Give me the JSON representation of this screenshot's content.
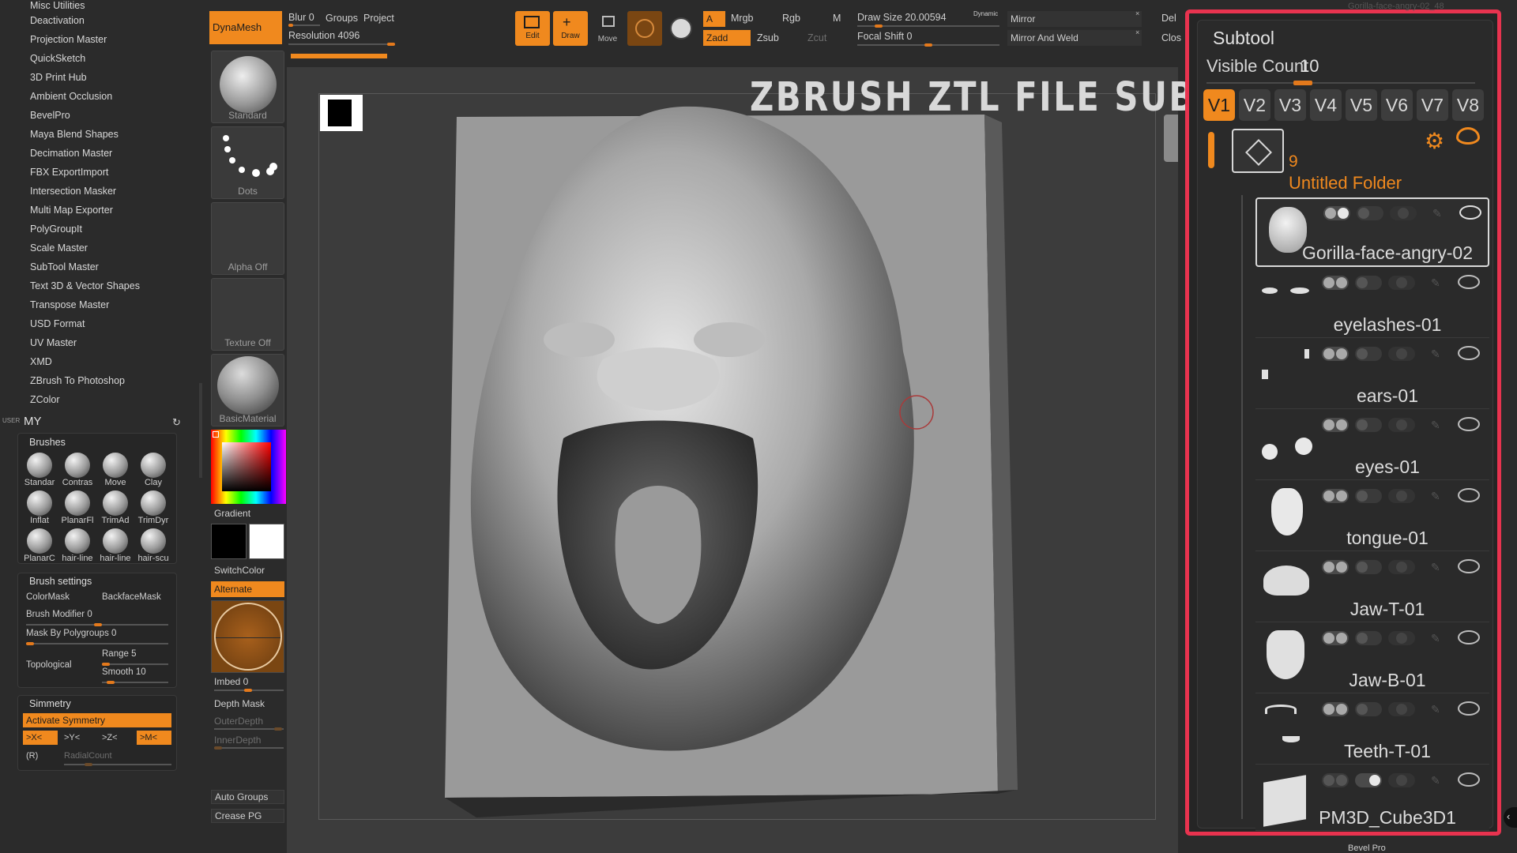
{
  "plugins": [
    "Misc Utilities",
    "Deactivation",
    "Projection Master",
    "QuickSketch",
    "3D Print Hub",
    "Ambient Occlusion",
    "BevelPro",
    "Maya Blend Shapes",
    "Decimation Master",
    "FBX ExportImport",
    "Intersection Masker",
    "Multi Map Exporter",
    "PolyGroupIt",
    "Scale Master",
    "SubTool Master",
    "Text 3D & Vector Shapes",
    "Transpose Master",
    "USD Format",
    "UV Master",
    "XMD",
    "ZBrush To Photoshop",
    "ZColor"
  ],
  "user_menu": {
    "tag": "USER",
    "title": "MY"
  },
  "brushes_panel": {
    "title": "Brushes",
    "items": [
      "Standar",
      "Contras",
      "Move",
      "Clay",
      "Inflat",
      "PlanarFl",
      "TrimAd",
      "TrimDyr",
      "PlanarC",
      "hair-line",
      "hair-line",
      "hair-scu"
    ]
  },
  "brush_settings": {
    "title": "Brush settings",
    "color_mask": "ColorMask",
    "backface_mask": "BackfaceMask",
    "brush_modifier": "Brush Modifier 0",
    "mask_by_polygroups": "Mask By Polygroups 0",
    "topological": "Topological",
    "range": "Range 5",
    "smooth": "Smooth 10"
  },
  "symmetry": {
    "title": "Simmetry",
    "activate": "Activate Symmetry",
    "x": ">X<",
    "y": ">Y<",
    "z": ">Z<",
    "m": ">M<",
    "r": "(R)",
    "radial": "RadialCount"
  },
  "tool_column": {
    "dynamesh": "DynaMesh",
    "standard": "Standard",
    "dots": "Dots",
    "alpha": "Alpha Off",
    "texture": "Texture Off",
    "material": "BasicMaterial",
    "gradient": "Gradient",
    "switch_color": "SwitchColor",
    "alternate": "Alternate",
    "imbed": "Imbed 0",
    "depth_mask": "Depth Mask",
    "outer_depth": "OuterDepth",
    "inner_depth": "InnerDepth",
    "auto_groups": "Auto Groups",
    "crease_pg": "Crease PG"
  },
  "topbar": {
    "blur": "Blur 0",
    "groups": "Groups",
    "project": "Project",
    "resolution": "Resolution 4096",
    "edit": "Edit",
    "draw": "Draw",
    "move": "Move",
    "a": "A",
    "mrgb": "Mrgb",
    "rgb": "Rgb",
    "m": "M",
    "zadd": "Zadd",
    "zsub": "Zsub",
    "zcut": "Zcut",
    "draw_size": "Draw Size 20.00594",
    "dynamic": "Dynamic",
    "focal_shift": "Focal Shift 0",
    "mirror": "Mirror",
    "mirror_weld": "Mirror And Weld",
    "del": "Del",
    "clos": "Clos"
  },
  "viewport": {
    "overlay_title": "ZBRUSH ZTL FILE SUBTOOLS"
  },
  "subtool": {
    "title": "Subtool",
    "visible_count": "Visible Count",
    "visible_count_value": "10",
    "versions": [
      "V1",
      "V2",
      "V3",
      "V4",
      "V5",
      "V6",
      "V7",
      "V8"
    ],
    "folder_count": "9",
    "folder_name": "Untitled Folder",
    "items": [
      "Gorilla-face-angry-02",
      "eyelashes-01",
      "ears-01",
      "eyes-01",
      "tongue-01",
      "Jaw-T-01",
      "Jaw-B-01",
      "Teeth-T-01",
      "PM3D_Cube3D1"
    ]
  },
  "right_edge": {
    "top": "Gorilla-face-angry-02_48",
    "bottom": "Bevel Pro"
  },
  "colors": {
    "accent": "#f0891e",
    "highlight": "#e8334f"
  }
}
